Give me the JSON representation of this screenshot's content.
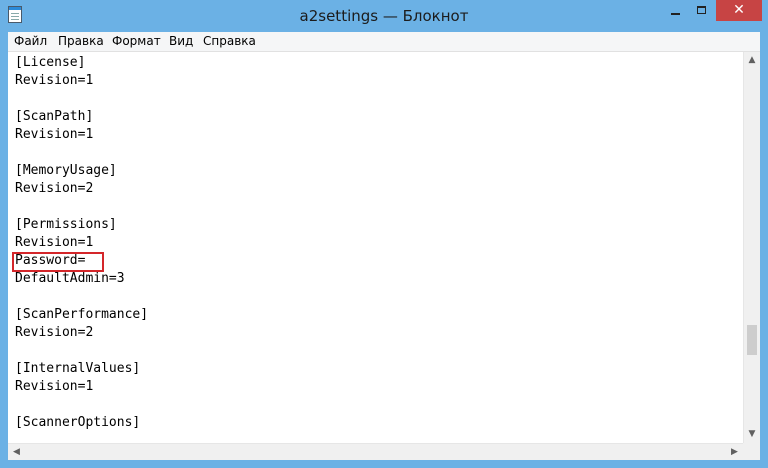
{
  "window": {
    "title": "a2settings — Блокнот"
  },
  "titlebar_controls": {
    "minimize": "—",
    "maximize": "☐",
    "close": "✕"
  },
  "menu": [
    "Файл",
    "Правка",
    "Формат",
    "Вид",
    "Справка"
  ],
  "document": {
    "lines": [
      "[License]",
      "Revision=1",
      "",
      "[ScanPath]",
      "Revision=1",
      "",
      "[MemoryUsage]",
      "Revision=2",
      "",
      "[Permissions]",
      "Revision=1",
      "Password=",
      "DefaultAdmin=3",
      "",
      "[ScanPerformance]",
      "Revision=2",
      "",
      "[InternalValues]",
      "Revision=1",
      "",
      "[ScannerOptions]"
    ],
    "highlighted_line": "Password="
  },
  "scrollbars": {
    "up": "▲",
    "down": "▼",
    "left": "◀",
    "right": "▶"
  },
  "colors": {
    "title_bar": "#6bb1e5",
    "close_button": "#c74444",
    "highlight_border": "#d4262a"
  }
}
